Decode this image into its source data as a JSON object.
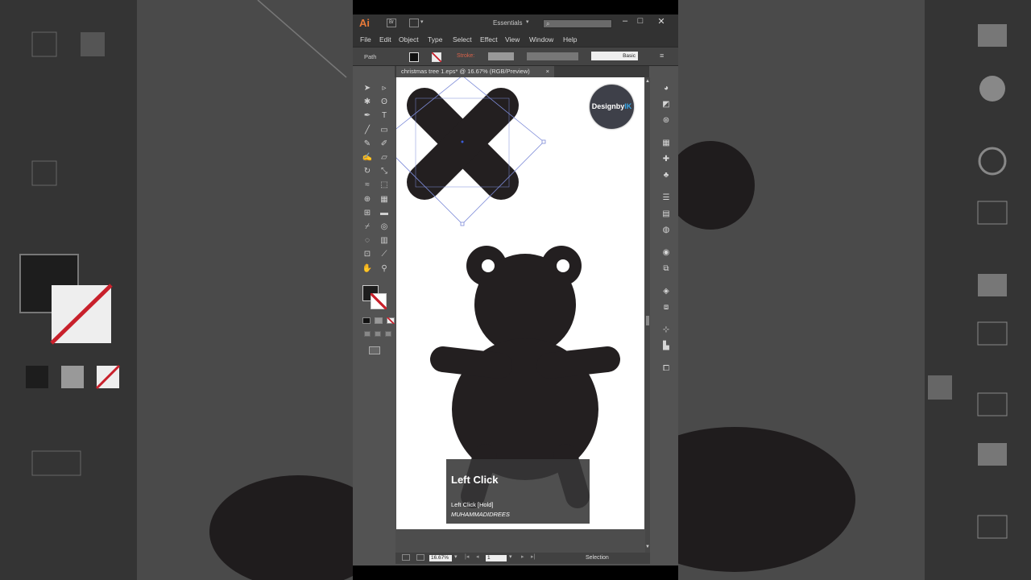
{
  "app": {
    "logo": "Ai",
    "bridge_label": "Br",
    "workspace": "Essentials",
    "search_glyph": "⌕"
  },
  "window_controls": {
    "minimize": "–",
    "maximize": "□",
    "close": "✕"
  },
  "menu": [
    "File",
    "Edit",
    "Object",
    "Type",
    "Select",
    "Effect",
    "View",
    "Window",
    "Help"
  ],
  "control_bar": {
    "selection_type": "Path",
    "stroke_label": "Stroke:",
    "brush_style": "Basic"
  },
  "document_tab": {
    "title": "christmas tree 1.eps* @ 16.67% (RGB/Preview)",
    "close": "×"
  },
  "status_bar": {
    "zoom": "16.67%",
    "page": "1",
    "tool": "Selection"
  },
  "badge": {
    "text": "Designby",
    "highlight": "IK"
  },
  "tooltip": {
    "title": "Left Click",
    "line1": "Left Click [Hold]",
    "line2": "MUHAMMADIDREES"
  },
  "colors": {
    "accent_logo": "#e87a39",
    "shape_fill": "#231f20",
    "stroke_label": "#d8634a",
    "badge_highlight": "#38a6e6",
    "selection": "#3b5bd6"
  }
}
